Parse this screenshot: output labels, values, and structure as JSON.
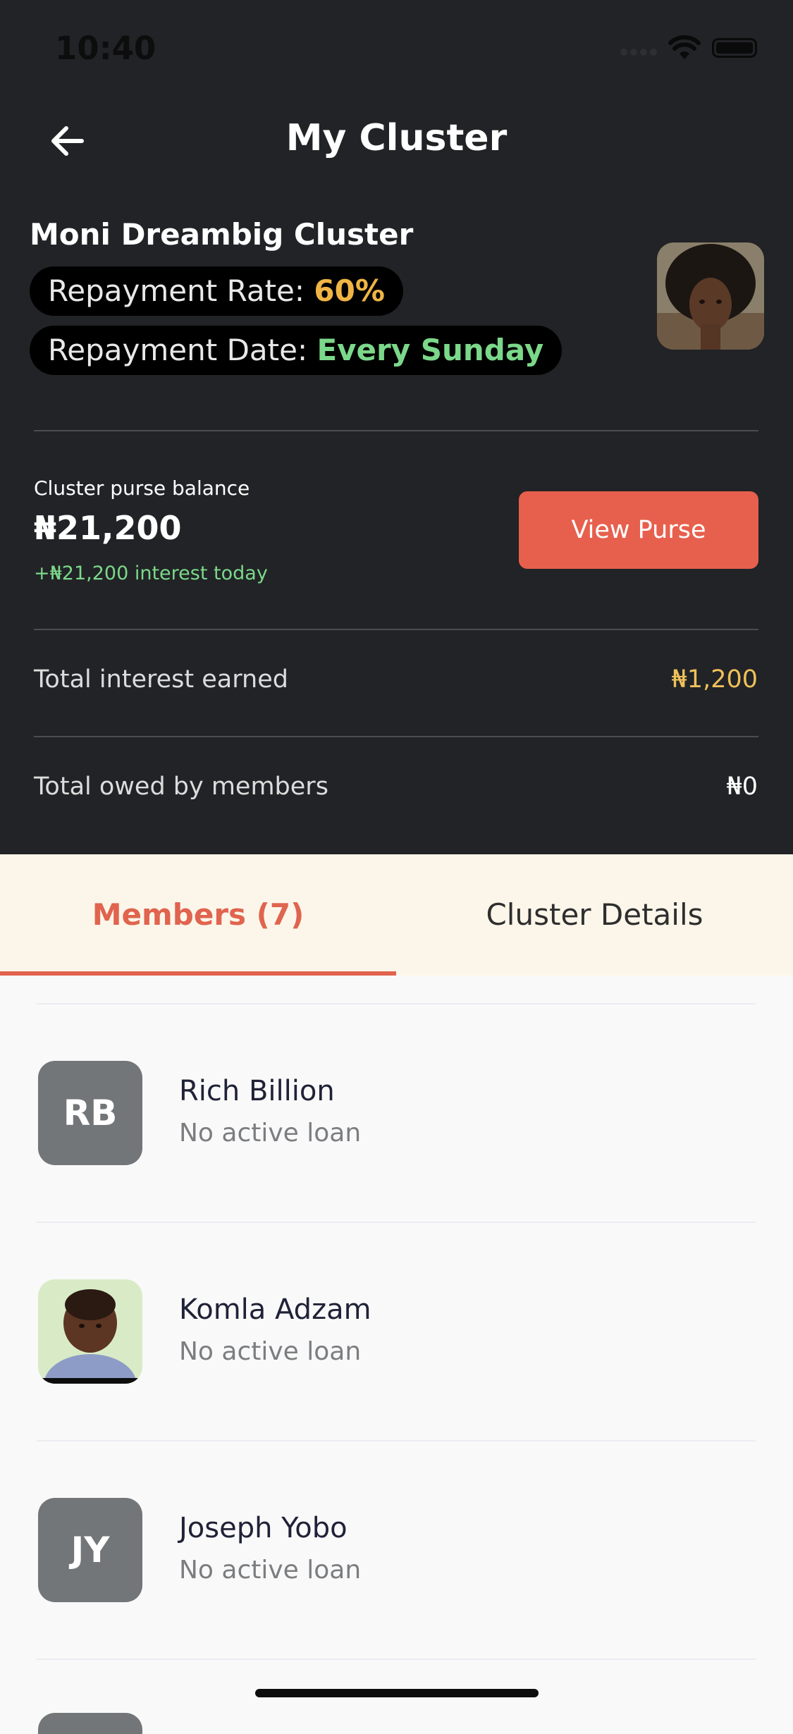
{
  "status_bar": {
    "time": "10:40"
  },
  "header": {
    "title": "My Cluster"
  },
  "cluster": {
    "name": "Moni Dreambig Cluster",
    "repayment_rate_label": "Repayment Rate: ",
    "repayment_rate_value": "60%",
    "repayment_date_label": "Repayment Date: ",
    "repayment_date_value": "Every Sunday"
  },
  "purse": {
    "label": "Cluster purse balance",
    "balance": "₦21,200",
    "interest_today": "+₦21,200 interest today",
    "view_button": "View Purse"
  },
  "summary": {
    "interest_label": "Total interest earned",
    "interest_value": "₦1,200",
    "owed_label": "Total owed by members",
    "owed_value": "₦0"
  },
  "tabs": [
    {
      "label": "Members (7)",
      "active": true
    },
    {
      "label": "Cluster Details",
      "active": false
    }
  ],
  "members": [
    {
      "initials": "RB",
      "name": "Rich Billion",
      "status": "No active loan"
    },
    {
      "initials": "",
      "name": "Komla Adzam",
      "status": "No active loan"
    },
    {
      "initials": "JY",
      "name": "Joseph Yobo",
      "status": "No active loan"
    }
  ],
  "colors": {
    "header_bg": "#212326",
    "accent": "#e7604d",
    "rate_value": "#efb544",
    "positive": "#7bd88a",
    "tab_bg": "#fcf6ea"
  }
}
